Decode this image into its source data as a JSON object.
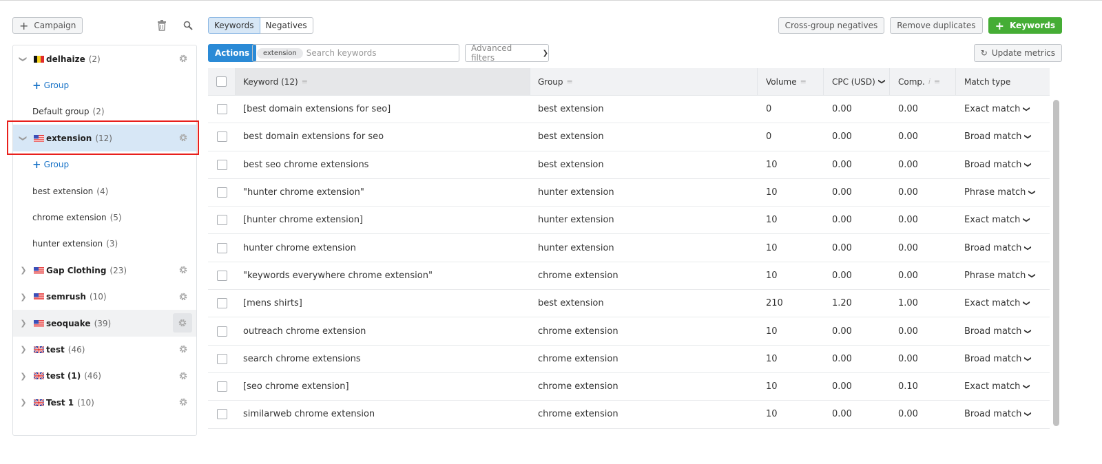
{
  "sidebar": {
    "campaign_button": "Campaign",
    "add_group_label": "Group",
    "campaigns": [
      {
        "name": "delhaize",
        "count": "(2)",
        "flag": "be",
        "expanded": true,
        "groups": [
          {
            "name": "Default group",
            "count": "(2)"
          }
        ]
      },
      {
        "name": "extension",
        "count": "(12)",
        "flag": "us",
        "expanded": true,
        "selected": true,
        "groups": [
          {
            "name": "best extension",
            "count": "(4)"
          },
          {
            "name": "chrome extension",
            "count": "(5)"
          },
          {
            "name": "hunter extension",
            "count": "(3)"
          }
        ]
      },
      {
        "name": "Gap Clothing",
        "count": "(23)",
        "flag": "us"
      },
      {
        "name": "semrush",
        "count": "(10)",
        "flag": "us"
      },
      {
        "name": "seoquake",
        "count": "(39)",
        "flag": "us",
        "hovered": true
      },
      {
        "name": "test",
        "count": "(46)",
        "flag": "gb"
      },
      {
        "name": "test (1)",
        "count": "(46)",
        "flag": "gb"
      },
      {
        "name": "Test 1",
        "count": "(10)",
        "flag": "gb"
      }
    ]
  },
  "tabs": [
    {
      "label": "Keywords",
      "active": true
    },
    {
      "label": "Negatives"
    }
  ],
  "toolbar": {
    "cross_group_label": "Cross-group negatives",
    "remove_duplicates_label": "Remove duplicates",
    "add_keywords_label": "Keywords",
    "actions_label": "Actions",
    "search_chip": "extension",
    "search_placeholder": "Search keywords",
    "search_value": "",
    "advanced_filters_label": "Advanced filters",
    "update_metrics_label": "Update metrics"
  },
  "table": {
    "columns": {
      "keyword": "Keyword (12)",
      "group": "Group",
      "volume": "Volume",
      "cpc": "CPC (USD)",
      "comp": "Comp.",
      "match_type": "Match type"
    },
    "rows": [
      {
        "keyword": "[best domain extensions for seo]",
        "group": "best extension",
        "volume": "0",
        "cpc": "0.00",
        "comp": "0.00",
        "match_type": "Exact match"
      },
      {
        "keyword": "best domain extensions for seo",
        "group": "best extension",
        "volume": "0",
        "cpc": "0.00",
        "comp": "0.00",
        "match_type": "Broad match"
      },
      {
        "keyword": "best seo chrome extensions",
        "group": "best extension",
        "volume": "10",
        "cpc": "0.00",
        "comp": "0.00",
        "match_type": "Broad match"
      },
      {
        "keyword": "\"hunter chrome extension\"",
        "group": "hunter extension",
        "volume": "10",
        "cpc": "0.00",
        "comp": "0.00",
        "match_type": "Phrase match"
      },
      {
        "keyword": "[hunter chrome extension]",
        "group": "hunter extension",
        "volume": "10",
        "cpc": "0.00",
        "comp": "0.00",
        "match_type": "Exact match"
      },
      {
        "keyword": "hunter chrome extension",
        "group": "hunter extension",
        "volume": "10",
        "cpc": "0.00",
        "comp": "0.00",
        "match_type": "Broad match"
      },
      {
        "keyword": "\"keywords everywhere chrome extension\"",
        "group": "chrome extension",
        "volume": "10",
        "cpc": "0.00",
        "comp": "0.00",
        "match_type": "Phrase match"
      },
      {
        "keyword": "[mens shirts]",
        "group": "best extension",
        "volume": "210",
        "cpc": "1.20",
        "comp": "1.00",
        "match_type": "Exact match"
      },
      {
        "keyword": "outreach chrome extension",
        "group": "chrome extension",
        "volume": "10",
        "cpc": "0.00",
        "comp": "0.00",
        "match_type": "Broad match"
      },
      {
        "keyword": "search chrome extensions",
        "group": "chrome extension",
        "volume": "10",
        "cpc": "0.00",
        "comp": "0.00",
        "match_type": "Broad match"
      },
      {
        "keyword": "[seo chrome extension]",
        "group": "chrome extension",
        "volume": "10",
        "cpc": "0.00",
        "comp": "0.10",
        "match_type": "Exact match"
      },
      {
        "keyword": "similarweb chrome extension",
        "group": "chrome extension",
        "volume": "10",
        "cpc": "0.00",
        "comp": "0.00",
        "match_type": "Broad match"
      }
    ]
  },
  "colors": {
    "accent_blue": "#2a8ad6",
    "accent_green": "#45ad35",
    "selected_bg": "#d7e7f6",
    "highlight_border": "#e8201c"
  }
}
